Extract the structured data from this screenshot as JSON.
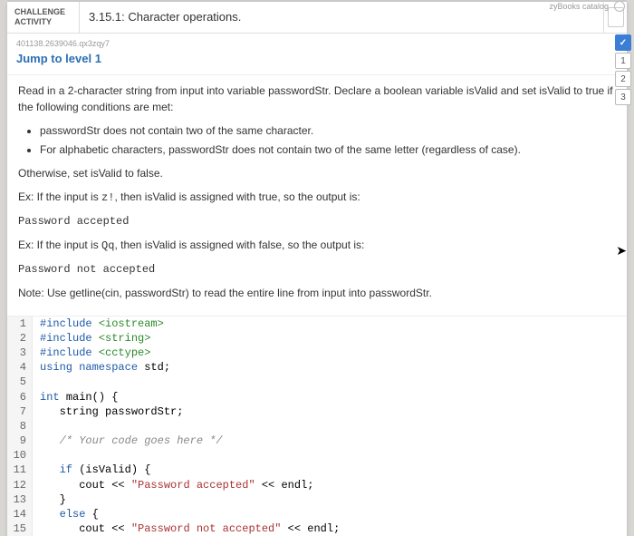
{
  "top_nav_text": "zyBooks catalog",
  "challenge": {
    "label_line1": "CHALLENGE",
    "label_line2": "ACTIVITY",
    "number_title": "3.15.1: Character operations."
  },
  "meta_id": "401138.2639046.qx3zqy7",
  "jump_link": "Jump to level 1",
  "instructions": {
    "intro": "Read in a 2-character string from input into variable passwordStr. Declare a boolean variable isValid and set isValid to true if the following conditions are met:",
    "bullet1": "passwordStr does not contain two of the same character.",
    "bullet2": "For alphabetic characters, passwordStr does not contain two of the same letter (regardless of case).",
    "otherwise": "Otherwise, set isValid to false.",
    "ex1_a": "Ex: If the input is ",
    "ex1_b": "z!",
    "ex1_c": ", then isValid is assigned with true, so the output is:",
    "out1": "Password accepted",
    "ex2_a": "Ex: If the input is ",
    "ex2_b": "Qq",
    "ex2_c": ", then isValid is assigned with false, so the output is:",
    "out2": "Password not accepted",
    "note": "Note: Use getline(cin, passwordStr) to read the entire line from input into passwordStr."
  },
  "code": {
    "l1a": "#include ",
    "l1b": "<iostream>",
    "l2a": "#include ",
    "l2b": "<string>",
    "l3a": "#include ",
    "l3b": "<cctype>",
    "l4a": "using namespace ",
    "l4b": "std;",
    "l5": "",
    "l6a": "int ",
    "l6b": "main() {",
    "l7": "   string passwordStr;",
    "l8": "",
    "l9": "   /* Your code goes here */",
    "l10": "",
    "l11a": "   if ",
    "l11b": "(isValid) {",
    "l12a": "      cout << ",
    "l12b": "\"Password accepted\"",
    "l12c": " << endl;",
    "l13": "   }",
    "l14a": "   else ",
    "l14b": "{",
    "l15a": "      cout << ",
    "l15b": "\"Password not accepted\"",
    "l15c": " << endl;"
  },
  "gutter": {
    "n1": "1",
    "n2": "2",
    "n3": "3",
    "n4": "4",
    "n5": "5",
    "n6": "6",
    "n7": "7",
    "n8": "8",
    "n9": "9",
    "n10": "10",
    "n11": "11",
    "n12": "12",
    "n13": "13",
    "n14": "14",
    "n15": "15"
  },
  "rail": {
    "check": "✓",
    "n1": "1",
    "n2": "2",
    "n3": "3"
  }
}
